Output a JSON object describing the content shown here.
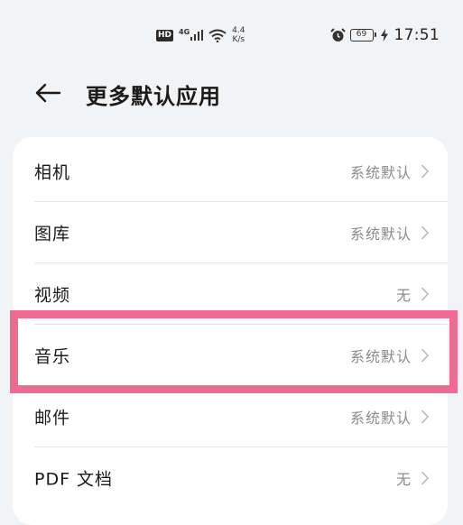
{
  "status_bar": {
    "hd_badge": "HD",
    "network_type": "4G",
    "speed_value": "4.4",
    "speed_unit": "K/s",
    "battery_level": "69",
    "time": "17:51"
  },
  "header": {
    "title": "更多默认应用"
  },
  "list": {
    "items": [
      {
        "label": "相机",
        "value": "系统默认"
      },
      {
        "label": "图库",
        "value": "系统默认"
      },
      {
        "label": "视频",
        "value": "无"
      },
      {
        "label": "音乐",
        "value": "系统默认"
      },
      {
        "label": "邮件",
        "value": "系统默认"
      },
      {
        "label": "PDF 文档",
        "value": "无"
      }
    ]
  },
  "colors": {
    "background": "#f1f3f5",
    "card": "#ffffff",
    "highlight": "#f06a94",
    "secondary_text": "#8a8a8a"
  }
}
